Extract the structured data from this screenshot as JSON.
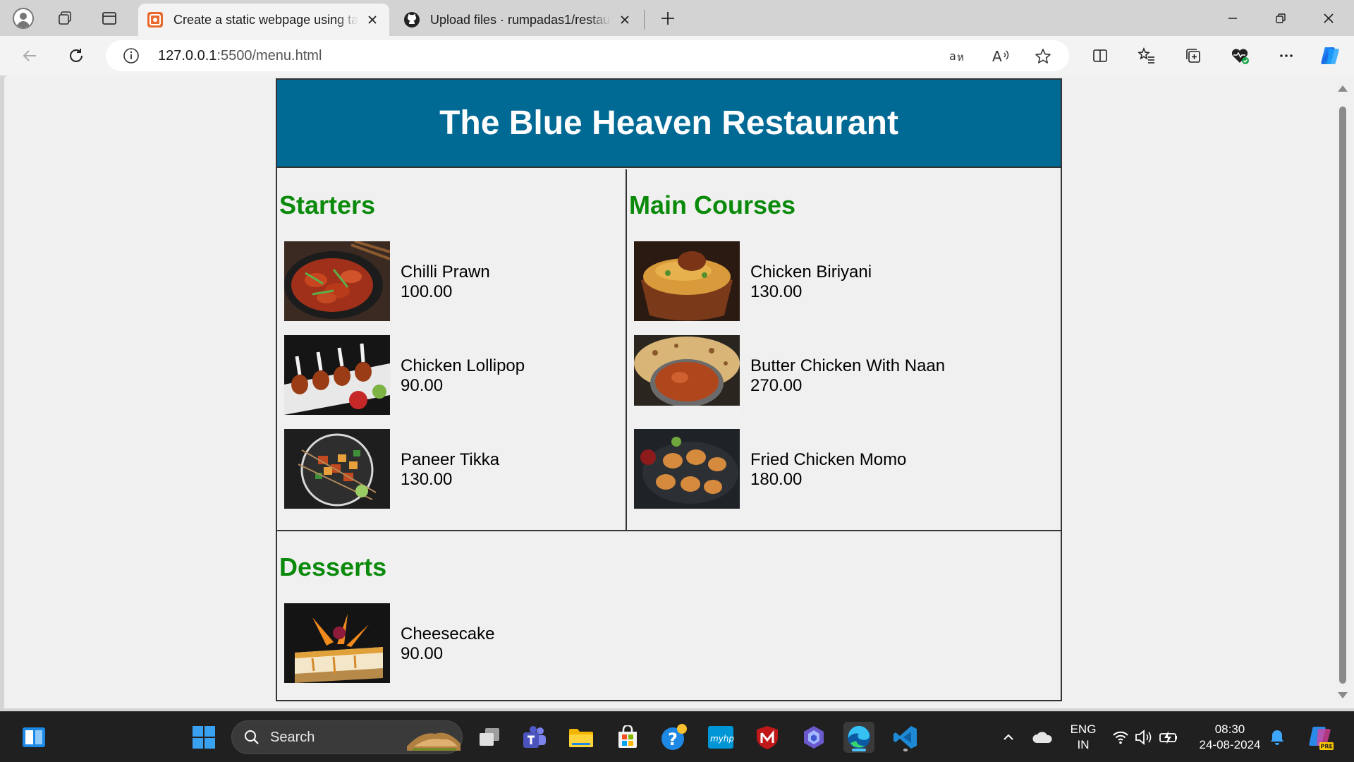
{
  "browser": {
    "tabs": [
      {
        "title": "Create a static webpage using table",
        "active": true,
        "favicon": "w3-code-icon"
      },
      {
        "title": "Upload files · rumpadas1/restaurant",
        "active": false,
        "favicon": "github-icon"
      }
    ],
    "address": {
      "host": "127.0.0.1",
      "port_path": ":5500/menu.html"
    }
  },
  "page": {
    "restaurant_name": "The Blue Heaven Restaurant",
    "sections": [
      {
        "title": "Starters",
        "items": [
          {
            "name": "Chilli Prawn",
            "price": "100.00"
          },
          {
            "name": "Chicken Lollipop",
            "price": "90.00"
          },
          {
            "name": "Paneer Tikka",
            "price": "130.00"
          }
        ]
      },
      {
        "title": "Main Courses",
        "items": [
          {
            "name": "Chicken Biriyani",
            "price": "130.00"
          },
          {
            "name": "Butter Chicken With Naan",
            "price": "270.00"
          },
          {
            "name": "Fried Chicken Momo",
            "price": "180.00"
          }
        ]
      },
      {
        "title": "Desserts",
        "items": [
          {
            "name": "Cheesecake",
            "price": "90.00"
          }
        ]
      }
    ],
    "colors": {
      "header_bg": "#006994",
      "section_title": "#0a8a0a"
    }
  },
  "taskbar": {
    "search_label": "Search",
    "language": {
      "line1": "ENG",
      "line2": "IN"
    },
    "clock": {
      "time": "08:30",
      "date": "24-08-2024"
    }
  }
}
